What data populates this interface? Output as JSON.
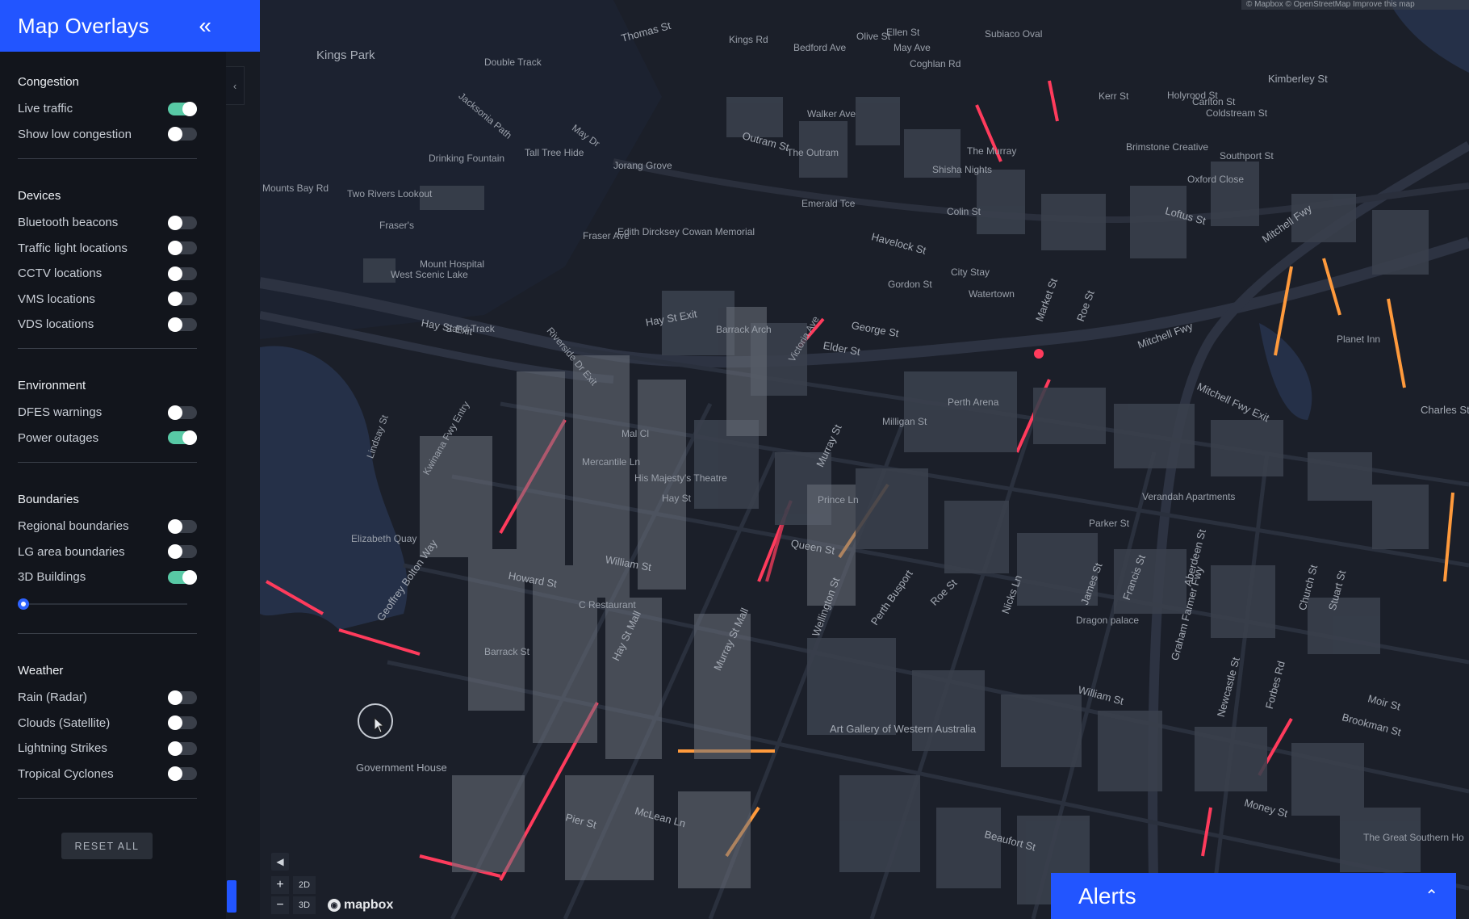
{
  "panel": {
    "title": "Map Overlays",
    "collapse_icon": "«",
    "reset_label": "RESET ALL",
    "sections": [
      {
        "title": "Congestion",
        "items": [
          {
            "label": "Live traffic",
            "on": true
          },
          {
            "label": "Show low congestion",
            "on": false
          }
        ]
      },
      {
        "title": "Devices",
        "items": [
          {
            "label": "Bluetooth beacons",
            "on": false
          },
          {
            "label": "Traffic light locations",
            "on": false
          },
          {
            "label": "CCTV locations",
            "on": false
          },
          {
            "label": "VMS locations",
            "on": false
          },
          {
            "label": "VDS locations",
            "on": false
          }
        ]
      },
      {
        "title": "Environment",
        "items": [
          {
            "label": "DFES warnings",
            "on": false
          },
          {
            "label": "Power outages",
            "on": true
          }
        ]
      },
      {
        "title": "Boundaries",
        "items": [
          {
            "label": "Regional boundaries",
            "on": false
          },
          {
            "label": "LG area boundaries",
            "on": false
          },
          {
            "label": "3D Buildings",
            "on": true
          }
        ]
      },
      {
        "title": "Weather",
        "items": [
          {
            "label": "Rain (Radar)",
            "on": false
          },
          {
            "label": "Clouds (Satellite)",
            "on": false
          },
          {
            "label": "Lightning Strikes",
            "on": false
          },
          {
            "label": "Tropical Cyclones",
            "on": false
          }
        ]
      }
    ],
    "buildings_slider_value": 0
  },
  "map_controls": {
    "collapse_icon": "◀",
    "zoom_in": "+",
    "zoom_out": "−",
    "mode_2d": "2D",
    "mode_3d": "3D",
    "logo_text": "mapbox",
    "attribution": "© Mapbox © OpenStreetMap Improve this map"
  },
  "alerts": {
    "title": "Alerts",
    "icon": "expand-up-icon"
  },
  "colors": {
    "accent": "#2255ff",
    "toggle_on": "#58c9a5",
    "traffic_heavy": "#ff3b5c",
    "traffic_medium": "#ff9a3c"
  },
  "map_labels": [
    "Kings Park",
    "Thomas St",
    "Kings Rd",
    "Bedford Ave",
    "Olive St",
    "Ellen St",
    "May Ave",
    "Coghlan Rd",
    "Subiaco Oval",
    "Kerr St",
    "Holyrood St",
    "Carlton St",
    "Coldstream St",
    "Kimberley St",
    "Drinking Fountain",
    "Tall Tree Hide",
    "Jorang Grove",
    "Outram St",
    "The Outram",
    "Walker Ave",
    "The Murray",
    "Brimstone Creative",
    "Southport St",
    "Oxford Close",
    "Shisha Nights",
    "Emerald Tce",
    "Loftus St",
    "Mitchell Fwy",
    "Fraser's",
    "Fraser Ave",
    "Edith Dircksey Cowan Memorial",
    "Mount Hospital",
    "West Scenic Lake",
    "Colin St",
    "City Stay",
    "Gordon St",
    "Watertown",
    "Havelock St",
    "Mitchell Fwy",
    "Hay St Exit",
    "Hay St Exit",
    "Barrack Arch",
    "George St",
    "Elder St",
    "Market St",
    "Roe St",
    "Planet Inn",
    "Mitchell Fwy Exit",
    "Charles St",
    "Perth Arena",
    "Milligan St",
    "Murray St",
    "Mal Cl",
    "Mercantile Ln",
    "His Majesty's Theatre",
    "Prince Ln",
    "Queen St",
    "Verandah Apartments",
    "Parker St",
    "Elizabeth Quay",
    "Geoffrey Bolton Way",
    "William St",
    "Howard St",
    "C Restaurant",
    "Hay St Mall",
    "Murray St Mall",
    "Wellington St",
    "Perth Busport",
    "Roe St",
    "Nicks Ln",
    "James St",
    "Francis St",
    "Aberdeen St",
    "Dragon palace",
    "Graham Farmer Fwy",
    "Church St",
    "Stuart St",
    "Government House",
    "Art Gallery of Western Australia",
    "William St",
    "Newcastle St",
    "Forbes Rd",
    "Brookman St",
    "Moir St",
    "McLean Ln",
    "Pier St",
    "Money St",
    "Beaufort St",
    "The Great Southern Ho",
    "Lindsay St",
    "Kwinana Fwy Entry",
    "Riverside Dr Exit",
    "Mounts Bay Rd",
    "Two Rivers Lookout",
    "May Dr",
    "Jacksonia Path",
    "Double Track",
    "Sand Track",
    "Hay St",
    "Victoria Ave",
    "Barrack St"
  ]
}
